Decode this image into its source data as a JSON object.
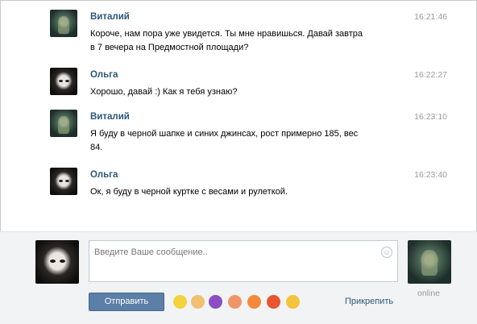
{
  "messages": [
    {
      "author": "Виталий",
      "avatar": "vitaliy-avatar",
      "time": "16:21:46",
      "lines": [
        "Короче, нам пора уже увидется. Ты мне нравишься. Давай завтра",
        "в 7 вечера на Предмостной площади?"
      ]
    },
    {
      "author": "Ольга",
      "avatar": "olga-avatar",
      "time": "16:22:27",
      "lines": [
        "Хорошо, давай :) Как я тебя узнаю?"
      ]
    },
    {
      "author": "Виталий",
      "avatar": "vitaliy-avatar",
      "time": "16:23:10",
      "lines": [
        "Я буду в черной шапке и синих джинсах, рост примерно 185, вес",
        "84."
      ]
    },
    {
      "author": "Ольга",
      "avatar": "olga-avatar",
      "time": "16:23:40",
      "lines": [
        "Ок, я буду в черной куртке с весами и рулеткой."
      ]
    }
  ],
  "composer": {
    "placeholder": "Введите Ваше сообщение..",
    "send_label": "Отправить",
    "attach_label": "Прикрепить",
    "partner_status": "online",
    "smile_icon": "smile-icon",
    "emoji_bar": [
      {
        "icon": "smiley-emoji",
        "glyph": "☺",
        "color": "#f4d23c"
      },
      {
        "icon": "thumbs-up-emoji",
        "glyph": "👍",
        "color": "#f0c070"
      },
      {
        "icon": "devil-emoji",
        "glyph": "😈",
        "color": "#8a4fc2"
      },
      {
        "icon": "peach-emoji",
        "glyph": "●",
        "color": "#f0956a"
      },
      {
        "icon": "laughing-emoji",
        "glyph": "😆",
        "color": "#f28a3a"
      },
      {
        "icon": "heart-emoji",
        "glyph": "♥",
        "color": "#e8552e"
      },
      {
        "icon": "grin-emoji",
        "glyph": "😄",
        "color": "#f4c23c"
      }
    ]
  },
  "colors": {
    "name": "#2b587a",
    "time": "#9a9a9a",
    "send_button": "#5b7fa6",
    "composer_bg": "#f2f3f4"
  }
}
